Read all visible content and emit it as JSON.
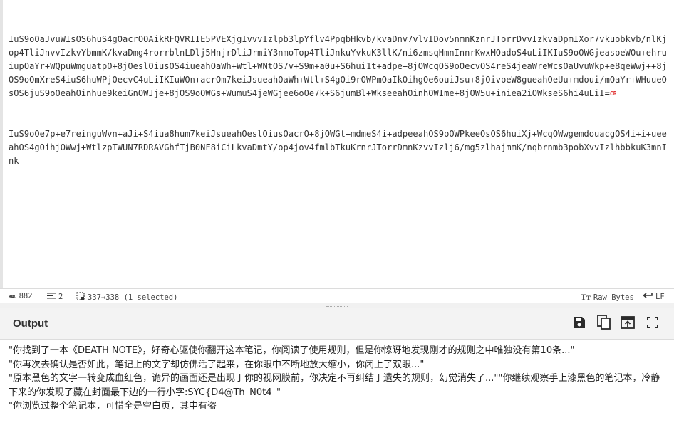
{
  "input": {
    "lines": [
      "IuS9oOaJvuWIsOS6huS4gOacrOOAikRFQVRIIE5PVEXjgIvvvIzlpb3lpYflv4PpqbHkvb/kvaDnv7vlvIDov5nmnKznrJTorrDvvIzkvaDpmIXor7vkuobkvb/nlKjop4TliJnvvIzkvYbmmK/kvaDmg4rorrblnLDlj5HnjrDliJrmiY3nmoTop4TliJnkuYvkuK3llK/ni6zmsqHmnInnrKwxMOadoS4uLiIKIuS9oOWGjeasoeWOu+ehruiupOaYr+WQpuWmguatpO+8jOeslOiusOS4iueahOaWh+Wtl+WNtOS7v+S9m+a0u+S6hui1t+adpe+8jOWcqOS9oOecvOS4reS4jeaWreWcsOaUvuWkp+e8qeWwj++8jOS9oOmXreS4iuS6huWPjOecvC4uLiIKIuWOn+acrOm7keiJsueahOaWh+Wtl+S4gOi9rOWPmOaIkOihgOe6ouiJsu+8jOivoeW8gueahOeUu+mdoui/mOaYr+WHuueOsOS6juS9oOeahOinhue9keiGnOWJje+8jOS9oOWGs+WumuS4jeWGjee6oOe7k+S6jumBl+WkseeahOinhOWIme+8jOW5u+iniea2iOWkseS6hi4uLiI=",
      "IuS9oOe7p+e7reinguWvn+aJi+S4iua8hum7keiJsueahOeslOiusOacrO+8jOWGt+mdmeS4i+adpeeahOS9oOWPkeeOsOS6huiXj+WcqOWwgemdouacgOS4i+i+ueeahOS4gOihjOWwj+WtlzpTWUN7RDRAVGhfTjB0NF8iCiLkvaDmtY/op4jov4fmlbTkuKrnrJTorrDmnKzvvIzlj6/mg5zlhajmmK/nqbrnmb3pobXvvIzlhbbkuK3mnInk"
    ],
    "cr_glyph": "CR"
  },
  "status": {
    "chars_label": "882",
    "lines_label": "2",
    "selection_label": "337→338 (1 selected)",
    "encoding_label": "Raw Bytes",
    "eol_label": "LF",
    "chars_icon": "rbc-icon",
    "lines_icon": "lines-icon",
    "selection_icon": "selection-icon",
    "encoding_icon": "text-format-icon",
    "eol_icon": "return-arrow-icon"
  },
  "output": {
    "title": "Output",
    "text": "\"你找到了一本《DEATH NOTE》，好奇心驱使你翻开这本笔记，你阅读了使用规则，但是你惊讶地发现刚才的规则之中唯独没有第10条...\"\n\"你再次去确认是否如此，笔记上的文字却仿佛活了起来，在你眼中不断地放大缩小，你闭上了双眼...\"\n\"原本黑色的文字一转变成血红色，诡异的画面还是出现于你的视网膜前，你决定不再纠结于遗失的规则，幻觉消失了...\"\"你继续观察手上漆黑色的笔记本，冷静下来的你发现了藏在封面最下边的一行小字:SYC{D4@Th_N0t4_\"\n\"你浏览过整个笔记本，可惜全是空白页，其中有盗",
    "toolbar": {
      "save": "save-icon",
      "copy": "copy-icon",
      "replace_input": "replace-input-icon",
      "maximise": "maximise-icon"
    }
  },
  "colors": {
    "highlight": "#dbeefd",
    "cursor_highlight": "#ffe74a",
    "cr_mark": "#e03030"
  }
}
